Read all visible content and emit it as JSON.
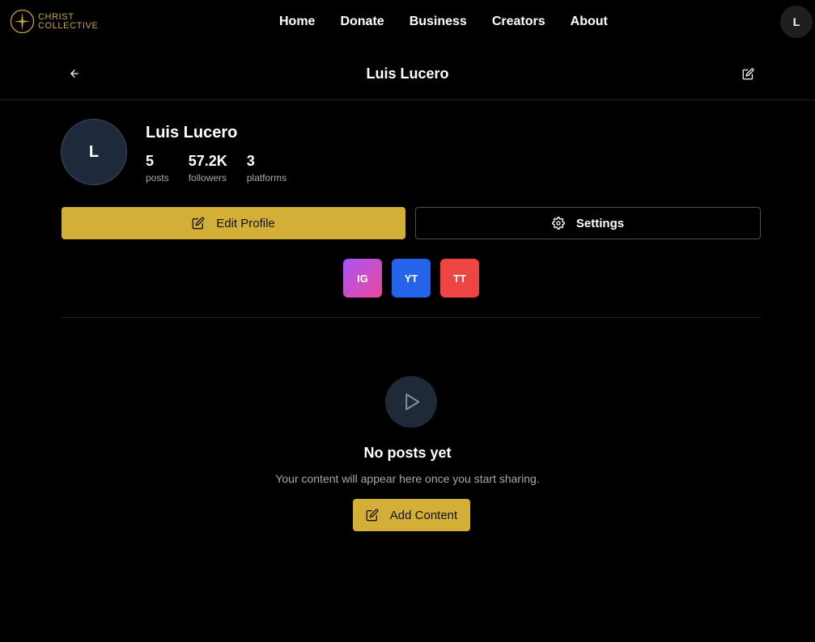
{
  "brand": {
    "line1": "CHRIST",
    "line2": "COLLECTIVE",
    "accent": "#d4af37"
  },
  "nav": {
    "links": [
      "Home",
      "Donate",
      "Business",
      "Creators",
      "About"
    ],
    "user_initial": "L"
  },
  "header": {
    "title": "Luis Lucero",
    "back_icon": "arrow-left-icon",
    "edit_icon": "edit-icon"
  },
  "profile": {
    "initial": "L",
    "name": "Luis Lucero",
    "stats": [
      {
        "value": "5",
        "label": "posts"
      },
      {
        "value": "57.2K",
        "label": "followers"
      },
      {
        "value": "3",
        "label": "platforms"
      }
    ]
  },
  "actions": {
    "edit_profile": "Edit Profile",
    "settings": "Settings"
  },
  "platforms": [
    {
      "label": "IG",
      "color": "#c04fd8"
    },
    {
      "label": "YT",
      "color": "#2563eb"
    },
    {
      "label": "TT",
      "color": "#ef4444"
    }
  ],
  "empty_state": {
    "title": "No posts yet",
    "subtitle": "Your content will appear here once you start sharing.",
    "button": "Add Content",
    "icon": "play-icon"
  }
}
